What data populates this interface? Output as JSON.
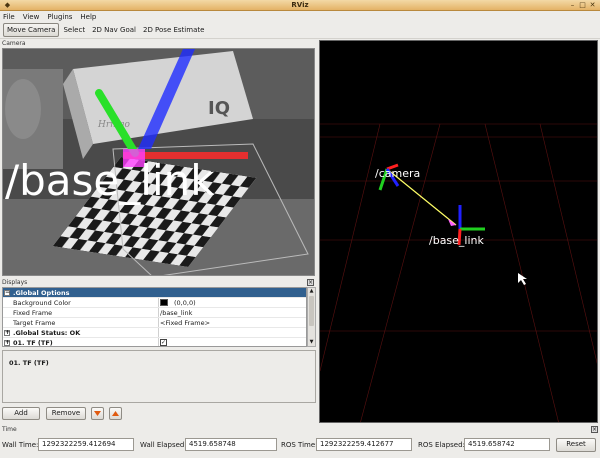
{
  "window": {
    "title": "RViz"
  },
  "menu": [
    "File",
    "View",
    "Plugins",
    "Help"
  ],
  "toolbar": [
    "Move Camera",
    "Select",
    "2D Nav Goal",
    "2D Pose Estimate"
  ],
  "camera_panel": {
    "label": "Camera",
    "overlay_text": "/base_link",
    "box_text": "IQ",
    "brand": "Hrmgo"
  },
  "displays": {
    "label": "Displays",
    "rows": [
      {
        "key": ".Global Options",
        "value": ""
      },
      {
        "key": "Background Color",
        "value": "(0,0,0)"
      },
      {
        "key": "Fixed Frame",
        "value": "/base_link"
      },
      {
        "key": "Target Frame",
        "value": "<Fixed Frame>"
      },
      {
        "key": ".Global Status: OK",
        "value": ""
      },
      {
        "key": "01. TF (TF)",
        "value": ""
      }
    ],
    "description": "01. TF (TF)"
  },
  "buttons": {
    "add": "Add",
    "remove": "Remove"
  },
  "view3d": {
    "frame_camera": "/camera",
    "frame_base": "/base_link"
  },
  "time": {
    "label": "Time",
    "wall_time_label": "Wall Time:",
    "wall_time": "1292322259.412694",
    "wall_elapsed_label": "Wall Elapsed:",
    "wall_elapsed": "4519.658748",
    "ros_time_label": "ROS Time:",
    "ros_time": "1292322259.412677",
    "ros_elapsed_label": "ROS Elapsed:",
    "ros_elapsed": "4519.658742",
    "reset": "Reset"
  },
  "colors": {
    "selection": "#31608f",
    "title_bar": "#e4b266",
    "axis_x": "#ff2020",
    "axis_y": "#20d020",
    "axis_z": "#2020ff"
  }
}
